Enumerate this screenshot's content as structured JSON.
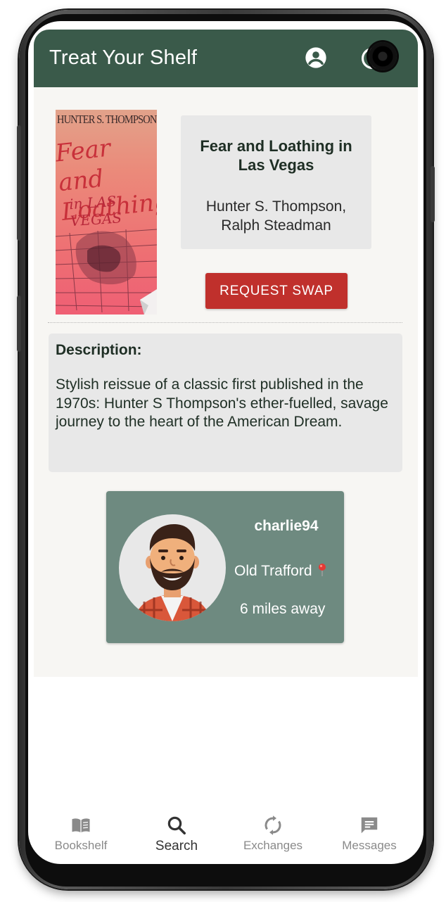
{
  "app": {
    "title": "Treat Your Shelf"
  },
  "book": {
    "cover": {
      "author_text": "HUNTER S. THOMPSON",
      "title_text": "Fear and Loathing",
      "subtitle_text": "in LAS VEGAS"
    },
    "title": "Fear and Loathing in Las Vegas",
    "authors": "Hunter S. Thompson, Ralph Steadman",
    "request_button_label": "REQUEST SWAP"
  },
  "description": {
    "heading": "Description:",
    "text": "Stylish reissue of a classic first published in the 1970s: Hunter S Thompson's ether-fuelled, savage journey to the heart of the American Dream."
  },
  "owner": {
    "username": "charlie94",
    "location": "Old Trafford",
    "distance": "6 miles away"
  },
  "nav": {
    "items": [
      {
        "label": "Bookshelf",
        "icon": "book-icon",
        "active": false
      },
      {
        "label": "Search",
        "icon": "search-icon",
        "active": true
      },
      {
        "label": "Exchanges",
        "icon": "sync-icon",
        "active": false
      },
      {
        "label": "Messages",
        "icon": "message-icon",
        "active": false
      }
    ]
  },
  "colors": {
    "appbar": "#3a5a4a",
    "swap_button": "#c0302c",
    "user_card": "#6e8a80",
    "panel": "#e8e8e8",
    "background": "#f7f6f3"
  }
}
